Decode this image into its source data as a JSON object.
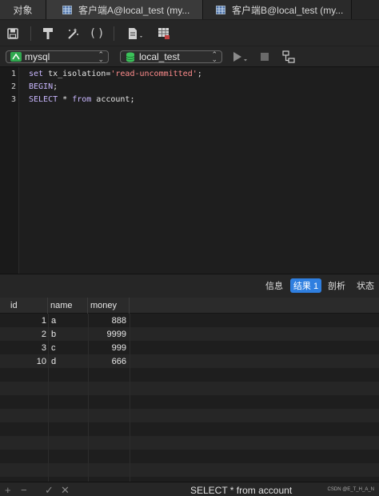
{
  "tabs": [
    {
      "label": "对象"
    },
    {
      "label": "客户端A@local_test (my..."
    },
    {
      "label": "客户端B@local_test (my..."
    }
  ],
  "toolbar": {
    "icons": [
      "save-icon",
      "format-icon",
      "beautify-icon",
      "parentheses-icon",
      "document-icon",
      "table-grid-icon"
    ]
  },
  "selectors": {
    "connection": "mysql",
    "database": "local_test"
  },
  "editor": {
    "line_numbers": [
      "1",
      "2",
      "3"
    ],
    "lines": [
      "set tx_isolation='read-uncommitted';",
      "BEGIN;",
      "SELECT * from account;"
    ]
  },
  "result_tabs": {
    "info": "信息",
    "result1": "结果 1",
    "profile": "剖析",
    "status": "状态"
  },
  "grid": {
    "columns": [
      "id",
      "name",
      "money"
    ],
    "rows": [
      [
        "1",
        "a",
        "888"
      ],
      [
        "2",
        "b",
        "9999"
      ],
      [
        "3",
        "c",
        "999"
      ],
      [
        "10",
        "d",
        "666"
      ]
    ]
  },
  "statusbar": {
    "query": "SELECT * from account",
    "watermark": "CSDN @E_T_H_A_N"
  },
  "colors": {
    "accent": "#2f7fe0",
    "keyword": "#c9b7ff",
    "string": "#ff8c8c"
  }
}
